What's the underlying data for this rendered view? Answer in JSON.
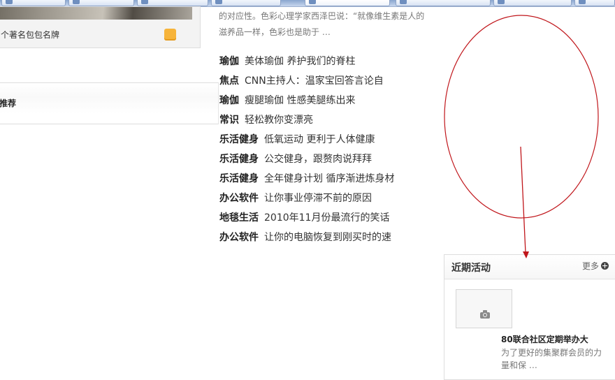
{
  "intro": {
    "line1": "的对应性。色彩心理学家西泽巴说：“就像维生素是人的",
    "line2": "滋养品一样，色彩也是助于 …"
  },
  "left_card": {
    "caption": "个著名包包名牌",
    "icon": "orange-rounded-square-icon"
  },
  "left_box": {
    "title": "推荐"
  },
  "news": [
    {
      "category": "瑜伽",
      "title": "美体瑜伽 养护我们的脊柱"
    },
    {
      "category": "焦点",
      "title": "CNN主持人：温家宝回答言论自"
    },
    {
      "category": "瑜伽",
      "title": "瘦腿瑜伽 性感美腿练出来"
    },
    {
      "category": "常识",
      "title": "轻松教你变漂亮"
    },
    {
      "category": "乐活健身",
      "title": "低氧运动 更利于人体健康"
    },
    {
      "category": "乐活健身",
      "title": "公交健身，跟赘肉说拜拜"
    },
    {
      "category": "乐活健身",
      "title": "全年健身计划 循序渐进炼身材"
    },
    {
      "category": "办公软件",
      "title": "让你事业停滞不前的原因"
    },
    {
      "category": "地毯生活",
      "title": "2010年11月份最流行的笑话"
    },
    {
      "category": "办公软件",
      "title": "让你的电脑恢复到刚买时的速"
    }
  ],
  "activity": {
    "title": "近期活动",
    "more_label": "更多",
    "more_icon": "plus-circle-icon",
    "thumb_icon": "camera-icon",
    "item_name": "80联合社区定期举办大",
    "item_desc_line1": "为了更好的集聚群会员的力",
    "item_desc_line2": "量和保 …"
  },
  "annotation": {
    "color": "#c0161b",
    "shape": "ellipse-with-arrow"
  }
}
